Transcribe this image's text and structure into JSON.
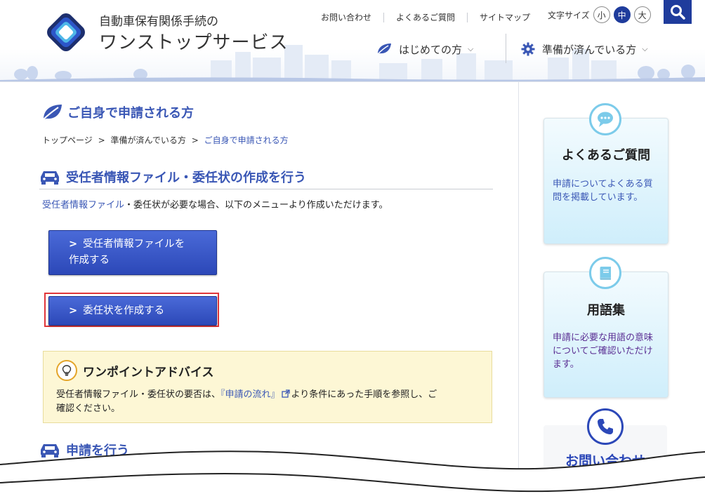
{
  "header": {
    "logo_line1": "自動車保有関係手続の",
    "logo_line2": "ワンストップサービス",
    "top_links": [
      "お問い合わせ",
      "よくあるご質問",
      "サイトマップ"
    ],
    "font_size_label": "文字サイズ",
    "font_size_options": [
      "小",
      "中",
      "大"
    ],
    "font_size_selected": "中",
    "nav": [
      {
        "label": "はじめての方",
        "icon": "leaf-icon"
      },
      {
        "label": "準備が済んでいる方",
        "icon": "gear-icon"
      }
    ]
  },
  "main": {
    "page_title": "ご自身で申請される方",
    "breadcrumb": [
      "トップページ",
      "準備が済んでいる方",
      "ご自身で申請される方"
    ],
    "breadcrumb_sep": ">",
    "section1_title": "受任者情報ファイル・委任状の作成を行う",
    "intro_link": "受任者情報ファイル",
    "intro_rest": "・委任状が必要な場合、以下のメニューより作成いただけます。",
    "button1_line1": "受任者情報ファイルを",
    "button1_line2": "作成する",
    "button2_label": "委任状を作成する",
    "advice_title": "ワンポイントアドバイス",
    "advice_before": "受任者情報ファイル・委任状の要否は、",
    "advice_link": "『申請の流れ』",
    "advice_after": "より条件にあった手順を参照し、ご",
    "advice_line2": "確認ください。",
    "section2_title": "申請を行う"
  },
  "sidebar": {
    "faq_title": "よくあるご質問",
    "faq_desc": "申請についてよくある質問を掲載しています。",
    "glossary_title": "用語集",
    "glossary_desc": "申請に必要な用語の意味についてご確認いただけます。",
    "contact_title": "お問い合わせ"
  },
  "colors": {
    "brand_blue": "#1f3c9c",
    "link_blue": "#3a57b5",
    "highlight_red": "#e0363a",
    "advice_bg": "#fdf7d5"
  }
}
